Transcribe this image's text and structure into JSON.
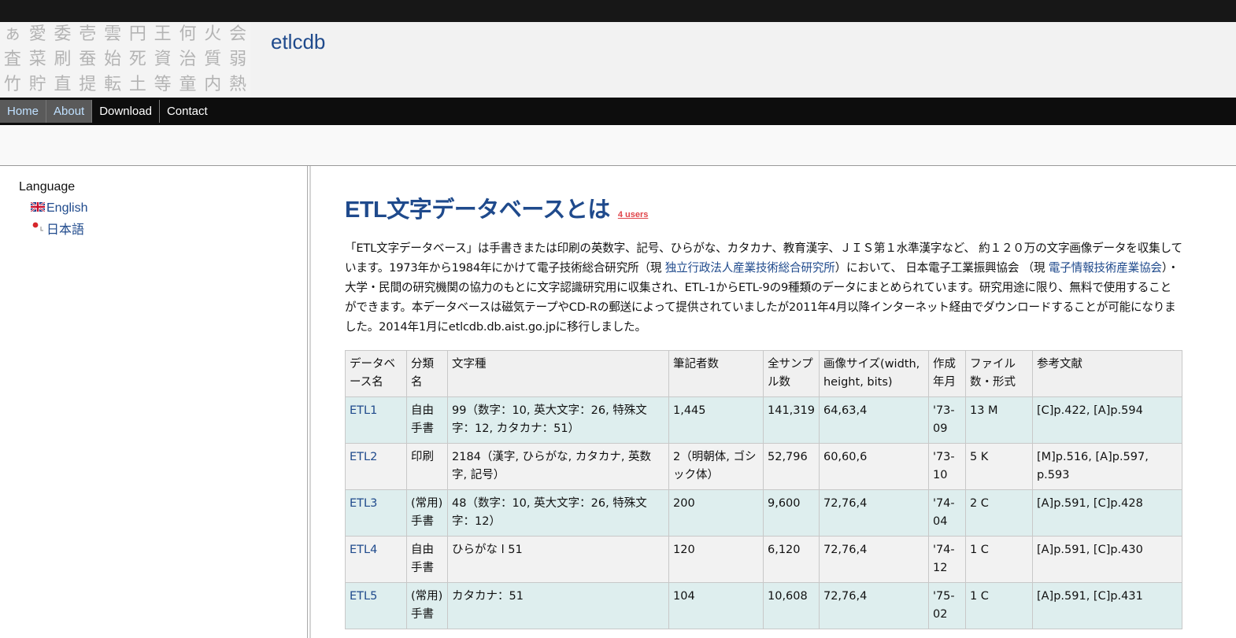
{
  "header": {
    "site_title": "etlcdb",
    "logo_chars": [
      "ぁ",
      "愛",
      "委",
      "壱",
      "雲",
      "円",
      "王",
      "何",
      "火",
      "会",
      "査",
      "菜",
      "刷",
      "蚕",
      "始",
      "死",
      "資",
      "治",
      "質",
      "弱",
      "竹",
      "貯",
      "直",
      "提",
      "転",
      "土",
      "等",
      "童",
      "内",
      "熱"
    ]
  },
  "nav": {
    "items": [
      {
        "label": "Home",
        "highlighted": true
      },
      {
        "label": "About",
        "highlighted": true
      },
      {
        "label": "Download",
        "highlighted": false
      },
      {
        "label": "Contact",
        "highlighted": false
      }
    ]
  },
  "sidebar": {
    "language_title": "Language",
    "languages": [
      {
        "label": "English",
        "icon": "uk-flag-icon"
      },
      {
        "label": "日本語",
        "icon": "japan-flag-icon"
      }
    ]
  },
  "main": {
    "title": "ETL文字データベースとは",
    "users_badge": "4 users",
    "intro": {
      "part1": "「ETL文字データベース」は手書きまたは印刷の英数字、記号、ひらがな、カタカナ、教育漢字、ＪＩＳ第１水準漢字など、 約１２０万の文字画像データを収集しています。1973年から1984年にかけて電子技術総合研究所（現 ",
      "link1": "独立行政法人産業技術総合研究所",
      "part2": "）において、 日本電子工業振興協会 （現 ",
      "link2": "電子情報技術産業協会",
      "part3": "）・大学・民間の研究機関の協力のもとに文字認識研究用に収集され、ETL-1からETL-9の9種類のデータにまとめられています。研究用途に限り、無料で使用することができます。本データベースは磁気テープやCD-Rの郵送によって提供されていましたが2011年4月以降インターネット経由でダウンロードすることが可能になりました。2014年1月にetlcdb.db.aist.go.jpに移行しました。"
    },
    "table": {
      "headers": [
        "データベース名",
        "分類名",
        "文字種",
        "筆記者数",
        "全サンプル数",
        "画像サイズ(width, height, bits)",
        "作成年月",
        "ファイル数・形式",
        "参考文献"
      ],
      "rows": [
        [
          "ETL1",
          "自由手書",
          "99（数字：10, 英大文字：26, 特殊文字：12, カタカナ：51）",
          "1,445",
          "141,319",
          "64,63,4",
          "'73-09",
          "13 M",
          "[C]p.422, [A]p.594"
        ],
        [
          "ETL2",
          "印刷",
          "2184（漢字, ひらがな, カタカナ, 英数字, 記号）",
          "2（明朝体, ゴシック体）",
          "52,796",
          "60,60,6",
          "'73-10",
          "5 K",
          "[M]p.516, [A]p.597, p.593"
        ],
        [
          "ETL3",
          "(常用)手書",
          "48（数字：10, 英大文字：26, 特殊文字：12）",
          "200",
          "9,600",
          "72,76,4",
          "'74-04",
          "2 C",
          "[A]p.591, [C]p.428"
        ],
        [
          "ETL4",
          "自由手書",
          "ひらがな l 51",
          "120",
          "6,120",
          "72,76,4",
          "'74-12",
          "1 C",
          "[A]p.591, [C]p.430"
        ],
        [
          "ETL5",
          "(常用)手書",
          "カタカナ：51",
          "104",
          "10,608",
          "72,76,4",
          "'75-02",
          "1 C",
          "[A]p.591, [C]p.431"
        ]
      ]
    }
  }
}
